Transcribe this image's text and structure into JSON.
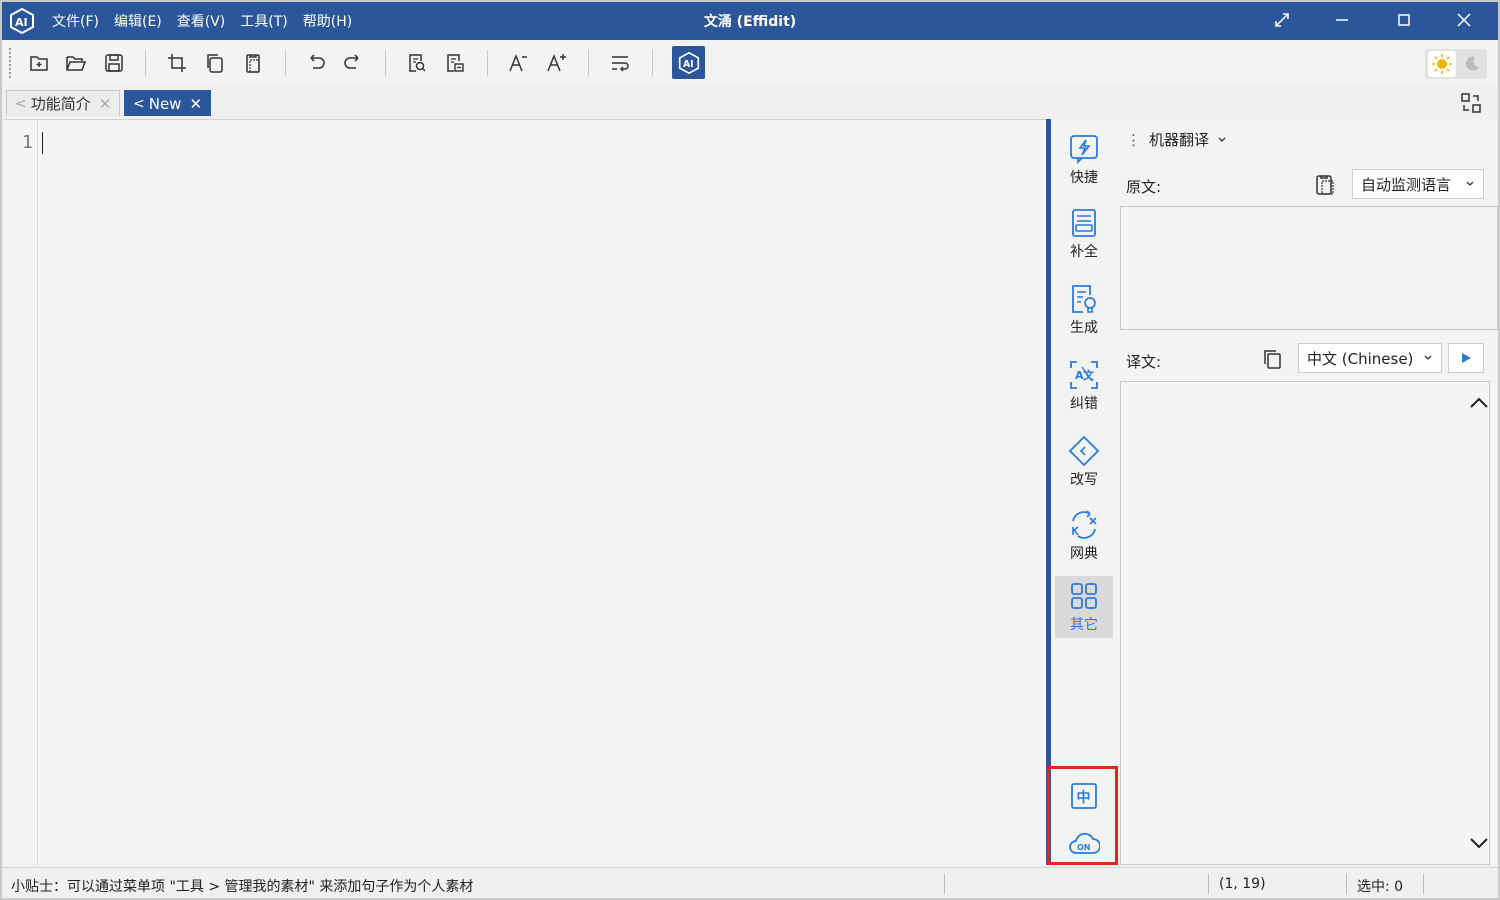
{
  "window": {
    "title": "文涌 (Effidit)",
    "menu": [
      "文件(F)",
      "编辑(E)",
      "查看(V)",
      "工具(T)",
      "帮助(H)"
    ]
  },
  "toolbar": {
    "icons": [
      "new-file-icon",
      "open-folder-icon",
      "save-icon",
      "crop-icon",
      "copy-icon",
      "paste-icon",
      "undo-icon",
      "redo-icon",
      "find-icon",
      "replace-icon",
      "font-decrease-icon",
      "font-increase-icon",
      "wrap-icon",
      "ai-assistant-icon"
    ],
    "accent": "#2b579a"
  },
  "tabs": [
    {
      "label": "功能简介",
      "active": false
    },
    {
      "label": "New",
      "active": true
    }
  ],
  "editor": {
    "line_number": "1"
  },
  "side_tools": [
    {
      "label": "快捷",
      "icon": "lightning-icon"
    },
    {
      "label": "补全",
      "icon": "complete-icon"
    },
    {
      "label": "生成",
      "icon": "generate-icon"
    },
    {
      "label": "纠错",
      "icon": "correct-icon"
    },
    {
      "label": "改写",
      "icon": "rewrite-icon"
    },
    {
      "label": "网典",
      "icon": "dictionary-icon"
    },
    {
      "label": "其它",
      "icon": "grid-icon",
      "selected": true
    }
  ],
  "translation": {
    "panel_title": "机器翻译",
    "source_label": "原文:",
    "source_language": "自动监测语言",
    "target_label": "译文:",
    "target_language": "中文 (Chinese)"
  },
  "bottom_icons": [
    "chinese-mode-icon",
    "cloud-on-icon"
  ],
  "status": {
    "tip": "小贴士：可以通过菜单项 \"工具 > 管理我的素材\" 来添加句子作为个人素材",
    "position": "(1, 19)",
    "selection": "选中: 0"
  }
}
